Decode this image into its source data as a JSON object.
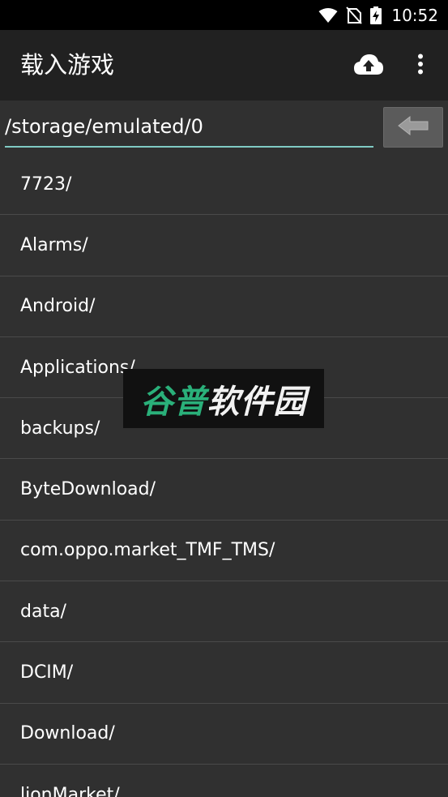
{
  "status_bar": {
    "time": "10:52",
    "icons": [
      "wifi-icon",
      "no-sim-icon",
      "battery-charging-icon"
    ]
  },
  "app_bar": {
    "title": "载入游戏",
    "actions": [
      "cloud-upload-icon",
      "more-vert-icon"
    ]
  },
  "path_bar": {
    "path": "/storage/emulated/0",
    "back_icon": "arrow-left-icon"
  },
  "files": [
    "7723/",
    "Alarms/",
    "Android/",
    "Applications/",
    "backups/",
    "ByteDownload/",
    "com.oppo.market_TMF_TMS/",
    "data/",
    "DCIM/",
    "Download/",
    "lionMarket/"
  ],
  "watermark": {
    "part1": "谷普",
    "part2": "软件园"
  },
  "colors": {
    "background": "#303030",
    "app_bar": "#212121",
    "accent": "#80cbc4",
    "watermark_green": "#2ab07a"
  }
}
